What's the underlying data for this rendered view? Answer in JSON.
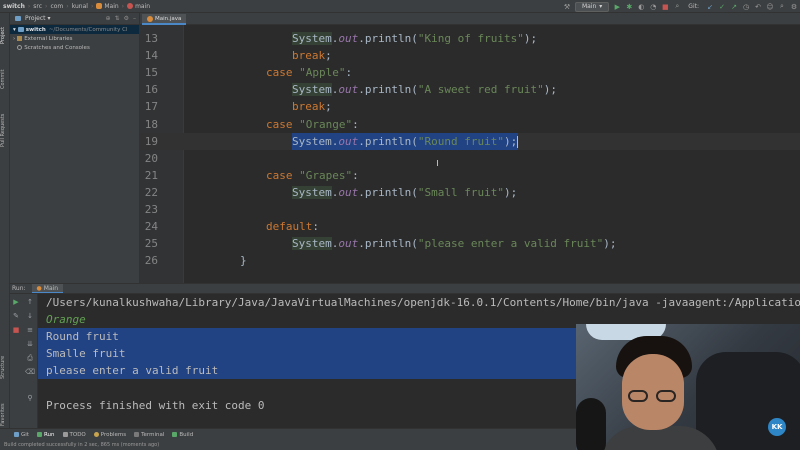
{
  "navbar": {
    "breadcrumbs": [
      "switch",
      "src",
      "com",
      "kunal",
      "Main",
      "main"
    ],
    "run_config": "Main",
    "git_label": "Git:"
  },
  "project_panel": {
    "title": "Project",
    "items": [
      {
        "label": "switch",
        "path": "~/Documents/Community Cl"
      },
      {
        "label": "External Libraries"
      },
      {
        "label": "Scratches and Consoles"
      }
    ]
  },
  "left_tabs": [
    "Project",
    "Commit",
    "Pull Requests",
    "Structure",
    "Favorites"
  ],
  "editor_tab": {
    "label": "Main.java"
  },
  "editor": {
    "lines": [
      {
        "n": "13",
        "indent": 1,
        "tokens": [
          [
            "cls",
            "System"
          ],
          [
            "p",
            "."
          ],
          [
            "fld",
            "out"
          ],
          [
            "p",
            ".println("
          ],
          [
            "str",
            "\"King of fruits\""
          ],
          [
            "p",
            ");"
          ]
        ]
      },
      {
        "n": "14",
        "indent": 1,
        "tokens": [
          [
            "kw",
            "break"
          ],
          [
            "p",
            ";"
          ]
        ]
      },
      {
        "n": "15",
        "indent": 0,
        "tokens": [
          [
            "kw",
            "case "
          ],
          [
            "str",
            "\"Apple\""
          ],
          [
            "p",
            ":"
          ]
        ]
      },
      {
        "n": "16",
        "indent": 1,
        "tokens": [
          [
            "cls",
            "System"
          ],
          [
            "p",
            "."
          ],
          [
            "fld",
            "out"
          ],
          [
            "p",
            ".println("
          ],
          [
            "str",
            "\"A sweet red fruit\""
          ],
          [
            "p",
            ");"
          ]
        ]
      },
      {
        "n": "17",
        "indent": 1,
        "tokens": [
          [
            "kw",
            "break"
          ],
          [
            "p",
            ";"
          ]
        ]
      },
      {
        "n": "18",
        "indent": 0,
        "tokens": [
          [
            "kw",
            "case "
          ],
          [
            "str",
            "\"Orange\""
          ],
          [
            "p",
            ":"
          ]
        ]
      },
      {
        "n": "19",
        "indent": 1,
        "selected": true,
        "tokens": [
          [
            "cls",
            "System"
          ],
          [
            "p",
            "."
          ],
          [
            "fld",
            "out"
          ],
          [
            "p",
            ".println("
          ],
          [
            "str",
            "\"Round fruit\""
          ],
          [
            "p",
            ");"
          ]
        ]
      },
      {
        "n": "20",
        "indent": 0,
        "tokens": []
      },
      {
        "n": "21",
        "indent": 0,
        "tokens": [
          [
            "kw",
            "case "
          ],
          [
            "str",
            "\"Grapes\""
          ],
          [
            "p",
            ":"
          ]
        ]
      },
      {
        "n": "22",
        "indent": 1,
        "tokens": [
          [
            "cls",
            "System"
          ],
          [
            "p",
            "."
          ],
          [
            "fld",
            "out"
          ],
          [
            "p",
            ".println("
          ],
          [
            "str",
            "\"Small fruit\""
          ],
          [
            "p",
            ");"
          ]
        ]
      },
      {
        "n": "23",
        "indent": 0,
        "tokens": []
      },
      {
        "n": "24",
        "indent": 0,
        "tokens": [
          [
            "kw",
            "default"
          ],
          [
            "p",
            ":"
          ]
        ]
      },
      {
        "n": "25",
        "indent": 1,
        "tokens": [
          [
            "cls",
            "System"
          ],
          [
            "p",
            "."
          ],
          [
            "fld",
            "out"
          ],
          [
            "p",
            ".println("
          ],
          [
            "str",
            "\"please enter a valid fruit\""
          ],
          [
            "p",
            ");"
          ]
        ]
      },
      {
        "n": "26",
        "indent": -1,
        "tokens": [
          [
            "p",
            "}"
          ]
        ]
      }
    ]
  },
  "run_panel": {
    "label": "Run:",
    "tab": "Main",
    "console": [
      {
        "text": "/Users/kunalkushwaha/Library/Java/JavaVirtualMachines/openjdk-16.0.1/Contents/Home/bin/java -javaagent:/Application",
        "kind": "cmd"
      },
      {
        "text": "Orange",
        "kind": "input"
      },
      {
        "text": "Round fruit",
        "kind": "sel"
      },
      {
        "text": "Smalle fruit",
        "kind": "sel"
      },
      {
        "text": "please enter a valid fruit",
        "kind": "sel"
      },
      {
        "text": "",
        "kind": "blank"
      },
      {
        "text": "Process finished with exit code 0",
        "kind": "done"
      }
    ]
  },
  "bottom_tools": [
    "Git",
    "Run",
    "TODO",
    "Problems",
    "Terminal",
    "Build"
  ],
  "status_text": "Build completed successfully in 2 sec, 865 ms (moments ago)",
  "webcam_badge": "KK",
  "colors": {
    "keyword": "#cc7832",
    "string": "#6a8759",
    "field": "#9876aa",
    "selection": "#214283"
  }
}
